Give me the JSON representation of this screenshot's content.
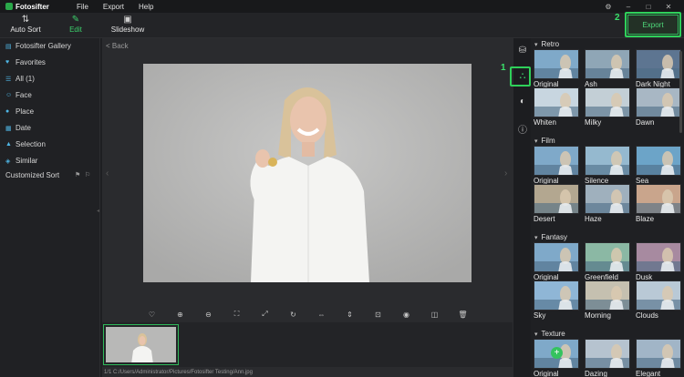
{
  "app": {
    "name": "Fotosifter"
  },
  "menu": [
    "File",
    "Export",
    "Help"
  ],
  "window_controls": {
    "settings": "⚙",
    "minimize": "–",
    "maximize": "□",
    "close": "✕"
  },
  "toolbar": {
    "auto_sort": "Auto Sort",
    "edit": "Edit",
    "slideshow": "Slideshow",
    "export": "Export"
  },
  "callouts": {
    "one": "1",
    "two": "2"
  },
  "sidebar": {
    "gallery": "Fotosifter Gallery",
    "favorites": "Favorites",
    "all": "All (1)",
    "face": "Face",
    "place": "Place",
    "date": "Date",
    "selection": "Selection",
    "similar": "Similar",
    "customized_sort": "Customized Sort"
  },
  "viewer": {
    "back": "< Back",
    "status": "1/1   C:/Users/Administrator/Pictures/Fotosifter Testing/Ann.jpg"
  },
  "filters": {
    "sections": [
      {
        "name": "Retro",
        "items": [
          "Original",
          "Ash",
          "Dark Night",
          "Whiten",
          "Milky",
          "Dawn"
        ]
      },
      {
        "name": "Film",
        "items": [
          "Original",
          "Silence",
          "Sea",
          "Desert",
          "Haze",
          "Blaze"
        ]
      },
      {
        "name": "Fantasy",
        "items": [
          "Original",
          "Greenfield",
          "Dusk",
          "Sky",
          "Morning",
          "Clouds"
        ]
      },
      {
        "name": "Texture",
        "items": [
          "Original",
          "Dazing",
          "Elegant"
        ]
      }
    ]
  },
  "colors": {
    "accent": "#2fb85a",
    "background": "#1e1f22"
  }
}
